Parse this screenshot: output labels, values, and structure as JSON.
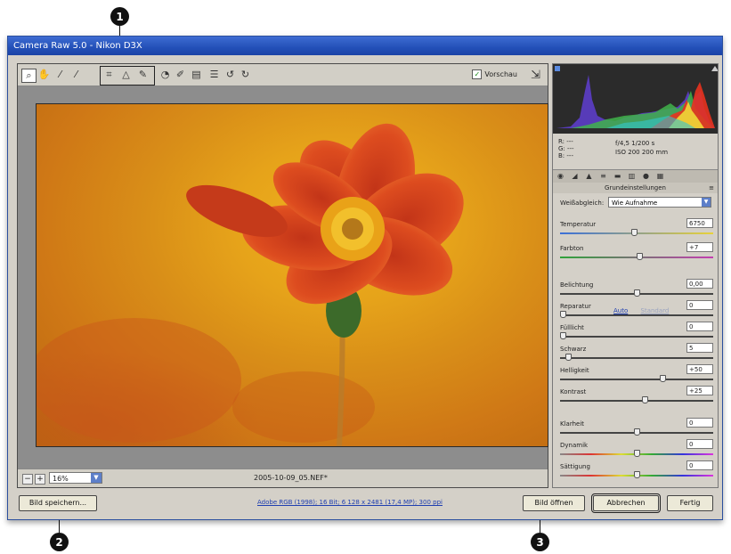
{
  "callouts": [
    "1",
    "2",
    "3"
  ],
  "window": {
    "title": "Camera Raw 5.0 - Nikon D3X"
  },
  "toolbar": {
    "tools": [
      {
        "name": "zoom-tool-icon",
        "glyph": "🔍"
      },
      {
        "name": "hand-tool-icon",
        "glyph": "✋"
      },
      {
        "name": "white-balance-tool-icon",
        "glyph": "⁄"
      },
      {
        "name": "color-sampler-tool-icon",
        "glyph": "⁄"
      },
      {
        "name": "crop-tool-icon",
        "glyph": "⌗"
      },
      {
        "name": "straighten-tool-icon",
        "glyph": "△"
      },
      {
        "name": "spot-removal-tool-icon",
        "glyph": "✎"
      },
      {
        "name": "red-eye-tool-icon",
        "glyph": "◉"
      },
      {
        "name": "adjustment-brush-icon",
        "glyph": "✐"
      },
      {
        "name": "graduated-filter-icon",
        "glyph": "▤"
      },
      {
        "name": "preferences-icon",
        "glyph": "☰"
      },
      {
        "name": "rotate-ccw-icon",
        "glyph": "↺"
      },
      {
        "name": "rotate-cw-icon",
        "glyph": "↻"
      }
    ],
    "preview_label": "Vorschau",
    "preview_checked": true
  },
  "statusbar": {
    "zoom": "16%",
    "filename": "2005-10-09_05.NEF*"
  },
  "info": {
    "r": "R:  ---",
    "g": "G:  ---",
    "b": "B:  ---",
    "exposure": "f/4,5   1/200 s",
    "iso_lens": "ISO 200   200 mm"
  },
  "panel": {
    "title": "Grundeinstellungen",
    "wb_label": "Weißabgleich:",
    "wb_value": "Wie Aufnahme",
    "auto": "Auto",
    "standard": "Standard",
    "sliders": [
      {
        "label": "Temperatur",
        "value": "6750",
        "level": 0.48,
        "track": "temp"
      },
      {
        "label": "Farbton",
        "value": "+7",
        "level": 0.52,
        "track": "tint"
      },
      {
        "label": "Belichtung",
        "value": "0,00",
        "level": 0.5,
        "track": "dark"
      },
      {
        "label": "Reparatur",
        "value": "0",
        "level": 0.0,
        "track": "dark"
      },
      {
        "label": "Fülllicht",
        "value": "0",
        "level": 0.0,
        "track": "dark"
      },
      {
        "label": "Schwarz",
        "value": "5",
        "level": 0.05,
        "track": "dark"
      },
      {
        "label": "Helligkeit",
        "value": "+50",
        "level": 0.67,
        "track": "dark"
      },
      {
        "label": "Kontrast",
        "value": "+25",
        "level": 0.55,
        "track": "dark"
      },
      {
        "label": "Klarheit",
        "value": "0",
        "level": 0.5,
        "track": "dark"
      },
      {
        "label": "Dynamik",
        "value": "0",
        "level": 0.5,
        "track": "sat"
      },
      {
        "label": "Sättigung",
        "value": "0",
        "level": 0.5,
        "track": "sat"
      }
    ]
  },
  "bottombar": {
    "save_label": "Bild speichern...",
    "workflow_link": "Adobe RGB (1998); 16 Bit; 6 128 x 2481 (17,4 MP); 300 ppi",
    "open_label": "Bild öffnen",
    "cancel_label": "Abbrechen",
    "done_label": "Fertig"
  },
  "colors": {
    "accent": "#2350b8",
    "photo_bg": "#e6a31a",
    "petal": "#d4421b",
    "center": "#f2b21e",
    "stem": "#3c6a2a"
  }
}
